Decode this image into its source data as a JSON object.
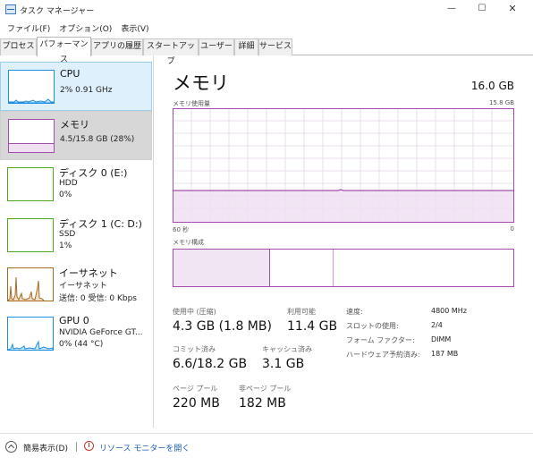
{
  "window": {
    "title": "タスク マネージャー",
    "minimize": "—",
    "maximize": "☐",
    "close": "✕"
  },
  "menu": [
    "ファイル(F)",
    "オプション(O)",
    "表示(V)"
  ],
  "tabs": [
    "プロセス",
    "パフォーマンス",
    "アプリの履歴",
    "スタートアップ",
    "ユーザー",
    "詳細",
    "サービス"
  ],
  "active_tab": "パフォーマンス",
  "sidebar": {
    "cpu": {
      "title": "CPU",
      "line1": "2% 0.91 GHz"
    },
    "mem": {
      "title": "メモリ",
      "line1": "4.5/15.8 GB (28%)"
    },
    "disk0": {
      "title": "ディスク 0 (E:)",
      "line1": "HDD",
      "line2": "0%"
    },
    "disk1": {
      "title": "ディスク 1 (C: D:)",
      "line1": "SSD",
      "line2": "1%"
    },
    "net": {
      "title": "イーサネット",
      "line1": "イーサネット",
      "line2": "送信: 0 受信: 0 Kbps"
    },
    "gpu": {
      "title": "GPU 0",
      "line1": "NVIDIA GeForce GT...",
      "line2": "0% (44 °C)"
    }
  },
  "main": {
    "title": "メモリ",
    "total": "16.0 GB",
    "graph_label": "メモリ使用量",
    "graph_max": "15.8 GB",
    "axis_left": "60 秒",
    "axis_right": "0",
    "composition_label": "メモリ構成",
    "memory_usage_fraction": 0.28
  },
  "stats": {
    "in_use_label": "使用中 (圧縮)",
    "in_use_value": "4.3 GB (1.8 MB)",
    "available_label": "利用可能",
    "available_value": "11.4 GB",
    "committed_label": "コミット済み",
    "committed_value": "6.6/18.2 GB",
    "cached_label": "キャッシュ済み",
    "cached_value": "3.1 GB",
    "paged_label": "ページ プール",
    "paged_value": "220 MB",
    "nonpaged_label": "非ページ プール",
    "nonpaged_value": "182 MB"
  },
  "specs": {
    "speed_key": "速度:",
    "speed_val": "4800 MHz",
    "slots_key": "スロットの使用:",
    "slots_val": "2/4",
    "form_key": "フォーム ファクター:",
    "form_val": "DIMM",
    "reserved_key": "ハードウェア予約済み:",
    "reserved_val": "187 MB"
  },
  "footer": {
    "fewer_details": "簡易表示(D)",
    "resource_monitor": "リソース モニターを開く"
  },
  "colors": {
    "memory": "#a24dab",
    "cpu": "#1b8ee0",
    "disk": "#4daa1f",
    "network": "#a8691f",
    "link": "#1a5fb4"
  }
}
